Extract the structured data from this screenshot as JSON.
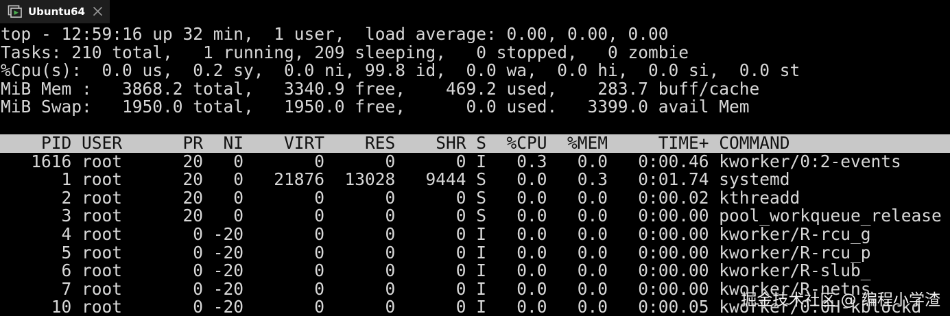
{
  "window": {
    "tab_title": "Ubuntu64",
    "tab_icon": "vm-window-icon",
    "close_icon": "close-icon"
  },
  "top": {
    "summary": [
      "top - 12:59:16 up 32 min,  1 user,  load average: 0.00, 0.00, 0.00",
      "Tasks: 210 total,   1 running, 209 sleeping,   0 stopped,   0 zombie",
      "%Cpu(s):  0.0 us,  0.2 sy,  0.0 ni, 99.8 id,  0.0 wa,  0.0 hi,  0.0 si,  0.0 st",
      "MiB Mem :   3868.2 total,   3340.9 free,    469.2 used,    283.7 buff/cache",
      "MiB Swap:   1950.0 total,   1950.0 free,      0.0 used.   3399.0 avail Mem"
    ],
    "columns": [
      "PID",
      "USER",
      "PR",
      "NI",
      "VIRT",
      "RES",
      "SHR",
      "S",
      "%CPU",
      "%MEM",
      "TIME+",
      "COMMAND"
    ],
    "rows": [
      {
        "pid": "1616",
        "user": "root",
        "pr": "20",
        "ni": "0",
        "virt": "0",
        "res": "0",
        "shr": "0",
        "s": "I",
        "cpu": "0.3",
        "mem": "0.0",
        "time": "0:00.46",
        "command": "kworker/0:2-events"
      },
      {
        "pid": "1",
        "user": "root",
        "pr": "20",
        "ni": "0",
        "virt": "21876",
        "res": "13028",
        "shr": "9444",
        "s": "S",
        "cpu": "0.0",
        "mem": "0.3",
        "time": "0:01.74",
        "command": "systemd"
      },
      {
        "pid": "2",
        "user": "root",
        "pr": "20",
        "ni": "0",
        "virt": "0",
        "res": "0",
        "shr": "0",
        "s": "S",
        "cpu": "0.0",
        "mem": "0.0",
        "time": "0:00.02",
        "command": "kthreadd"
      },
      {
        "pid": "3",
        "user": "root",
        "pr": "20",
        "ni": "0",
        "virt": "0",
        "res": "0",
        "shr": "0",
        "s": "S",
        "cpu": "0.0",
        "mem": "0.0",
        "time": "0:00.00",
        "command": "pool_workqueue_release"
      },
      {
        "pid": "4",
        "user": "root",
        "pr": "0",
        "ni": "-20",
        "virt": "0",
        "res": "0",
        "shr": "0",
        "s": "I",
        "cpu": "0.0",
        "mem": "0.0",
        "time": "0:00.00",
        "command": "kworker/R-rcu_g"
      },
      {
        "pid": "5",
        "user": "root",
        "pr": "0",
        "ni": "-20",
        "virt": "0",
        "res": "0",
        "shr": "0",
        "s": "I",
        "cpu": "0.0",
        "mem": "0.0",
        "time": "0:00.00",
        "command": "kworker/R-rcu_p"
      },
      {
        "pid": "6",
        "user": "root",
        "pr": "0",
        "ni": "-20",
        "virt": "0",
        "res": "0",
        "shr": "0",
        "s": "I",
        "cpu": "0.0",
        "mem": "0.0",
        "time": "0:00.00",
        "command": "kworker/R-slub_"
      },
      {
        "pid": "7",
        "user": "root",
        "pr": "0",
        "ni": "-20",
        "virt": "0",
        "res": "0",
        "shr": "0",
        "s": "I",
        "cpu": "0.0",
        "mem": "0.0",
        "time": "0:00.00",
        "command": "kworker/R-netns"
      },
      {
        "pid": "10",
        "user": "root",
        "pr": "0",
        "ni": "-20",
        "virt": "0",
        "res": "0",
        "shr": "0",
        "s": "I",
        "cpu": "0.0",
        "mem": "0.0",
        "time": "0:00.05",
        "command": "kworker/0:0H-kblockd"
      }
    ]
  },
  "watermark": "掘金技术社区 @ 编程小学渣",
  "colors": {
    "terminal_bg": "#000000",
    "terminal_fg": "#d8d8d8",
    "header_bg": "#c8c8c8",
    "header_fg": "#111111",
    "tab_bg": "#1e1e1e",
    "icon_accent": "#4caf50"
  }
}
